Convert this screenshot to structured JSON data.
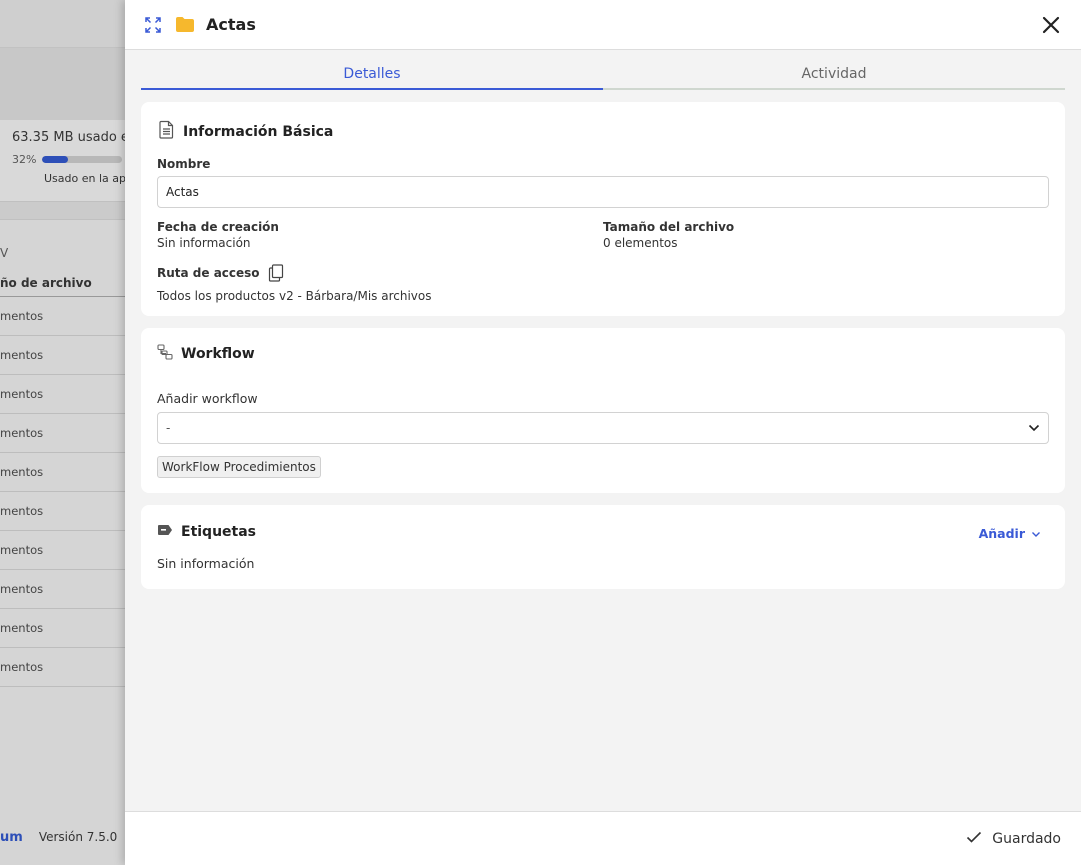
{
  "background": {
    "storage_text": "63.35 MB usado e",
    "percent_label": "32%",
    "percent_value": 0.32,
    "used_text": "Usado en la ap",
    "v_text": "V",
    "column_header": "ño de archivo",
    "rows": [
      "mentos",
      "mentos",
      "mentos",
      "mentos",
      "mentos",
      "mentos",
      "mentos",
      "mentos",
      "mentos",
      "mentos"
    ],
    "brand": "um",
    "version": "Versión 7.5.0"
  },
  "header": {
    "title": "Actas",
    "expand_icon": "expand-icon",
    "folder_icon": "folder-icon",
    "folder_color": "#f6b82d",
    "close_icon": "close-icon"
  },
  "tabs": [
    {
      "label": "Detalles",
      "active": true
    },
    {
      "label": "Actividad",
      "active": false
    }
  ],
  "basic_info": {
    "title": "Información Básica",
    "icon": "document-icon",
    "name_label": "Nombre",
    "name_value": "Actas",
    "created_label": "Fecha de creación",
    "created_value": "Sin información",
    "size_label": "Tamaño del archivo",
    "size_value": "0 elementos",
    "path_label": "Ruta de acceso",
    "path_value": "Todos los productos v2 - Bárbara/Mis archivos"
  },
  "workflow": {
    "title": "Workflow",
    "icon": "workflow-icon",
    "add_label": "Añadir workflow",
    "selected": "-",
    "chip": "WorkFlow Procedimientos"
  },
  "tags": {
    "title": "Etiquetas",
    "icon": "tag-icon",
    "add_label": "Añadir",
    "empty_text": "Sin información"
  },
  "footer": {
    "status": "Guardado"
  },
  "colors": {
    "accent": "#3a5ad6",
    "folder": "#f6b82d"
  }
}
